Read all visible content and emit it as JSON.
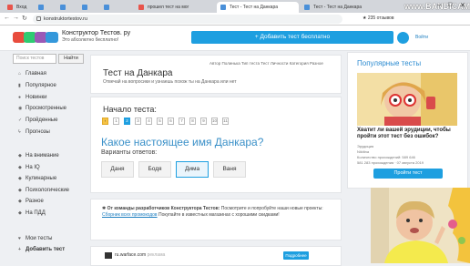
{
  "browser": {
    "tabs": [
      {
        "label": "Вход",
        "color": "#e8544b"
      },
      {
        "label": "",
        "color": "#4a90d9"
      },
      {
        "label": "",
        "color": "#4a90d9"
      },
      {
        "label": "",
        "color": "#4a90d9"
      },
      {
        "label": "",
        "color": "#4a90d9"
      },
      {
        "label": "прошел тест на мог",
        "color": "#e8544b"
      },
      {
        "label": "Тест - Тест на Данкара",
        "color": "#4a90d9"
      },
      {
        "label": "Тест - Тест на Данкара",
        "color": "#4a90d9"
      }
    ],
    "url": "konstruktortestov.ru",
    "recorder_watermark": "www.BANDICAM.com",
    "rating_text": "235 отзывов"
  },
  "header": {
    "site_name": "Конструктор Тестов. ру",
    "slogan": "Это абсолютно бесплатно!",
    "add_test_label": "+ Добавить тест бесплатно",
    "login_label": "Войти",
    "logo_colors": [
      "#e84c3d",
      "#2ecc71",
      "#9b59b6",
      "#3498db"
    ]
  },
  "sidebar": {
    "search_placeholder": "Поиск тестов",
    "find_label": "Найти",
    "items": [
      {
        "label": "Главная",
        "icon": "home-icon",
        "glyph": "⌂"
      },
      {
        "label": "Популярное",
        "icon": "chart-icon",
        "glyph": "▮"
      },
      {
        "label": "Новинки",
        "icon": "new-icon",
        "glyph": "●"
      },
      {
        "label": "Просмотренные",
        "icon": "eye-icon",
        "glyph": "◉"
      },
      {
        "label": "Пройденные",
        "icon": "check-icon",
        "glyph": "✓"
      },
      {
        "label": "Прогнозы",
        "icon": "bolt-icon",
        "glyph": "ϟ"
      }
    ],
    "categories": [
      "На внимание",
      "На IQ",
      "Кулинарные",
      "Психологические",
      "Разное",
      "На ПДД"
    ],
    "bottom": [
      {
        "label": "Мои тесты",
        "icon": "heart-icon",
        "glyph": "♥"
      },
      {
        "label": "Добавить тест",
        "icon": "plus-icon",
        "glyph": "+"
      }
    ]
  },
  "test": {
    "title": "Тест на Данкара",
    "subtitle": "Отвечай на вопросики и узнаешь похож ты на Данкара или нет",
    "meta": "Автор Полинька  Тип теста Тест Личности  Категория Разное",
    "start_title": "Начало теста:",
    "pages": [
      "1",
      "2",
      "3",
      "4",
      "5",
      "6",
      "7",
      "8",
      "9",
      "10",
      "11"
    ],
    "active_page_index": 1,
    "question": "Какое настоящее имя Данкара?",
    "variants_label": "Варианты ответов:",
    "answers": [
      "Даня",
      "Бодя",
      "Дима",
      "Ваня"
    ],
    "selected_answer_index": 2
  },
  "notice": {
    "bold": "От команды разработчиков Конструктора Тестов:",
    "text": " Посмотрите и попробуйте наши новые проекты: ",
    "link": "Сборник всех промокодов",
    "tail": " Покупайте в известных магазинах с хорошими скидками!"
  },
  "ad": {
    "url": "ru.warface.com",
    "tag": "реклама",
    "button": "Подробнее"
  },
  "right": {
    "title": "Популярные тесты",
    "caption": "Хватит ли вашей эрудиции, чтобы пройти этот тест без ошибок?",
    "type": "Эрудиция",
    "author": "Nikitina",
    "stats": "Количество прохождений: 589 646",
    "date": "581 283 прохождения · 07 августа 2019",
    "button": "Пройти тест"
  }
}
